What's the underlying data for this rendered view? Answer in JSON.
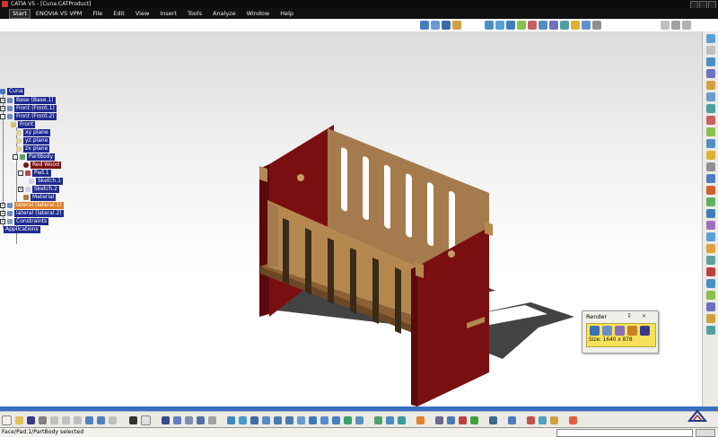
{
  "window": {
    "title": "CATIA V5 - [Cuna.CATProduct]"
  },
  "menu": {
    "start": "Start",
    "items": [
      "ENOVIA V5 VPM",
      "File",
      "Edit",
      "View",
      "Insert",
      "Tools",
      "Analyze",
      "Window",
      "Help"
    ]
  },
  "tree": {
    "root": "Cuna",
    "nodes": [
      {
        "label": "Base (Base.1)",
        "style": "blue"
      },
      {
        "label": "Front (Front.1)",
        "style": "blue"
      },
      {
        "label": "Front (Front.2)",
        "style": "blue"
      },
      {
        "label": "Front",
        "style": "blue"
      },
      {
        "label": "xy plane",
        "style": "blue"
      },
      {
        "label": "yz plane",
        "style": "blue"
      },
      {
        "label": "zx plane",
        "style": "blue"
      },
      {
        "label": "PartBody",
        "style": "blue"
      },
      {
        "label": "Red Wood",
        "style": "red"
      },
      {
        "label": "Pad.1",
        "style": "blue"
      },
      {
        "label": "Sketch.1",
        "style": "blue"
      },
      {
        "label": "Sketch.2",
        "style": "blue"
      },
      {
        "label": "Material",
        "style": "blue"
      },
      {
        "label": "lateral (lateral.1)",
        "style": "orange"
      },
      {
        "label": "lateral (lateral.2)",
        "style": "blue"
      },
      {
        "label": "Constraints",
        "style": "blue"
      },
      {
        "label": "Applications",
        "style": "blue"
      }
    ]
  },
  "render_panel": {
    "title": "Render",
    "size_text": "Size: 1640 x 878"
  },
  "status": {
    "text": "Face/Pad.1/PartBody selected"
  },
  "colors": {
    "wood_light": "#a57a4c",
    "wood_dark": "#6a4826",
    "red_wood": "#7a0f12",
    "tree_highlight": "#1f2a8f",
    "scroll_blue": "#3a6fc0"
  }
}
